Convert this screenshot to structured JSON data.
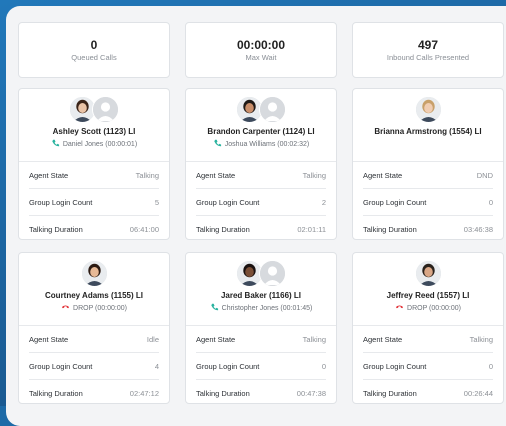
{
  "stats": [
    {
      "value": "0",
      "label": "Queued Calls"
    },
    {
      "value": "00:00:00",
      "label": "Max Wait"
    },
    {
      "value": "497",
      "label": "Inbound Calls Presented"
    }
  ],
  "agents": [
    {
      "name": "Ashley Scott (1123) LI",
      "call": "Daniel Jones (00:00:01)",
      "call_icon": "phone-talking-icon",
      "avatars": 2,
      "agent_state_label": "Agent State",
      "agent_state": "Talking",
      "group_login_label": "Group Login Count",
      "group_login": "5",
      "talking_duration_label": "Talking Duration",
      "talking_duration": "06:41:00"
    },
    {
      "name": "Brandon Carpenter (1124) LI",
      "call": "Joshua Williams (00:02:32)",
      "call_icon": "phone-talking-icon",
      "avatars": 2,
      "agent_state_label": "Agent State",
      "agent_state": "Talking",
      "group_login_label": "Group Login Count",
      "group_login": "2",
      "talking_duration_label": "Talking Duration",
      "talking_duration": "02:01:11"
    },
    {
      "name": "Brianna Armstrong (1554) LI",
      "call": "",
      "call_icon": "",
      "avatars": 1,
      "agent_state_label": "Agent State",
      "agent_state": "DND",
      "group_login_label": "Group Login Count",
      "group_login": "0",
      "talking_duration_label": "Talking Duration",
      "talking_duration": "03:46:38"
    },
    {
      "name": "Courtney Adams (1155) LI",
      "call": "DROP (00:00:00)",
      "call_icon": "phone-hangup-icon",
      "avatars": 1,
      "agent_state_label": "Agent State",
      "agent_state": "Idle",
      "group_login_label": "Group Login Count",
      "group_login": "4",
      "talking_duration_label": "Talking Duration",
      "talking_duration": "02:47:12"
    },
    {
      "name": "Jared Baker (1166) LI",
      "call": "Christopher Jones (00:01:45)",
      "call_icon": "phone-talking-icon",
      "avatars": 2,
      "agent_state_label": "Agent State",
      "agent_state": "Talking",
      "group_login_label": "Group Login Count",
      "group_login": "0",
      "talking_duration_label": "Talking Duration",
      "talking_duration": "00:47:38"
    },
    {
      "name": "Jeffrey Reed (1557) LI",
      "call": "DROP (00:00:00)",
      "call_icon": "phone-hangup-icon",
      "avatars": 1,
      "agent_state_label": "Agent State",
      "agent_state": "Talking",
      "group_login_label": "Group Login Count",
      "group_login": "0",
      "talking_duration_label": "Talking Duration",
      "talking_duration": "00:26:44"
    }
  ],
  "colors": {
    "background": "#1d6aa7",
    "talking_icon": "#2bb3a0",
    "hangup_icon": "#e0262c"
  }
}
